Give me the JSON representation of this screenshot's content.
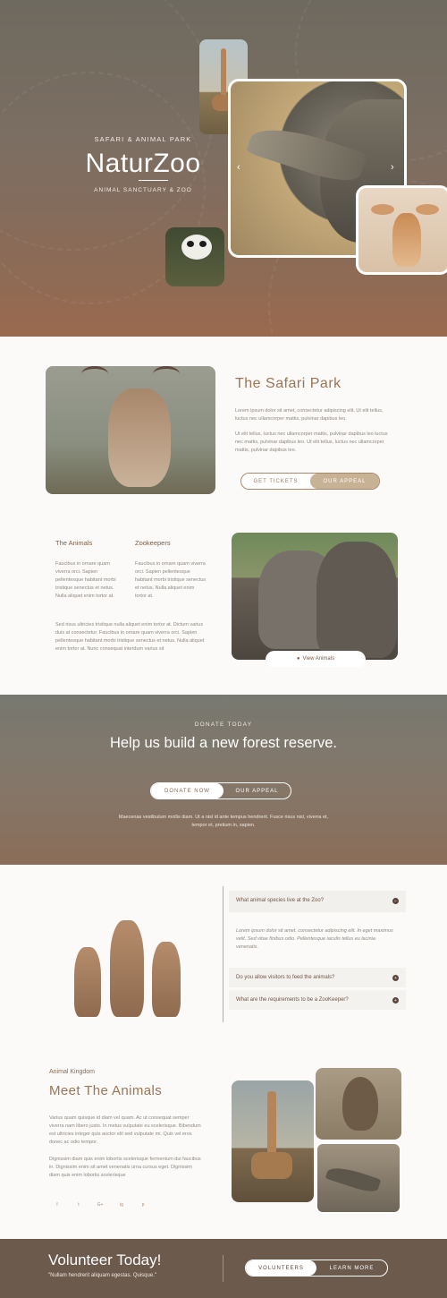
{
  "hero": {
    "kicker": "SAFARI & ANIMAL PARK",
    "title": "NaturZoo",
    "subtitle": "ANIMAL SANCTUARY & ZOO",
    "prev_arrow": "‹",
    "next_arrow": "›"
  },
  "safari": {
    "title": "The Safari Park",
    "para1": "Lorem ipsum dolor sit amet, consectetur adipiscing elit. Ut elit tellus, luctus nec ullamcorper mattis, pulvinar dapibus leo.",
    "para2": "Ut elit tellus, luctus nec ullamcorper mattis, pulvinar dapibus leo luctus nec mattis, pulvinar dapibus leo. Ut elit tellus, luctus nec ullamcorper mattis, pulvinar dapibus leo.",
    "btn_tickets": "GET TICKETS",
    "btn_appeal": "OUR APPEAL"
  },
  "columns": {
    "animals_title": "The Animals",
    "animals_text": "Faucibus in ornare quam viverra orci. Sapien pellentesque habitant morbi tristique senectus et netus. Nulla aliquet enim tortor at.",
    "keepers_title": "Zookeepers",
    "keepers_text": "Faucibus in ornare quam viverra orci. Sapien pellentesque habitant morbi tristique senectus et netus. Nulla aliquet enim tortor at.",
    "bottom_text": "Sed risus ultricies tristique nulla aliquet enim tortor at. Dictum varius duis at consectetur. Faucibus in ornare quam viverra orci. Sapien pellentesque habitant morbi tristique senectus et netus. Nulla aliquet enim tortor at. Nunc consequat interdum varius sit",
    "view_animals": "View Animals"
  },
  "donate": {
    "kicker": "DONATE TODAY",
    "title": "Help us build a new forest reserve.",
    "btn_donate": "DONATE NOW",
    "btn_appeal": "OUR APPEAL",
    "text": "Maecenas vestibulum mollis diam. Ut a nisl id ante tempus hendrerit. Fusce risus nisl, viverra et, tempor et, pretium in, sapien."
  },
  "faq": {
    "items": [
      {
        "q": "What animal species live at the Zoo?",
        "a": "Lorem ipsum dolor sit amet, consectetur adipiscing elit. In eget maximus velit. Sed vitae finibus odio. Pellentesque iaculis tellus eu lacinia venenatis.",
        "icon": "−"
      },
      {
        "q": "Do you allow visitors to feed the animals?",
        "icon": "+"
      },
      {
        "q": "What are the requirements to be a ZooKeeper?",
        "icon": "+"
      }
    ]
  },
  "meet": {
    "kicker": "Animal Kingdom",
    "title": "Meet The Animals",
    "para1": "Varius quam quisque id diam vel quam. Ac ut consequat semper viverra nam libero justo. In metus vulputate eu scelerisque. Bibendum est ultricies integer quis auctor elit sed vulputate mi. Quis vel eros donec ac odio tempor.",
    "para2": "Dignissim diam quis enim lobortis scelerisque fermentum dui faucibus in. Dignissim enim sit amet venenatis urna cursus eget. Dignissim diam quis enim lobortis scelerisque",
    "social": [
      "f",
      "t",
      "G+",
      "ig",
      "p"
    ]
  },
  "footer": {
    "title": "Volunteer Today!",
    "subtitle": "\"Nullam hendrerit aliquam egestas. Quisque.\"",
    "btn_volunteers": "VOLUNTEERS",
    "btn_learn": "LEARN MORE"
  }
}
